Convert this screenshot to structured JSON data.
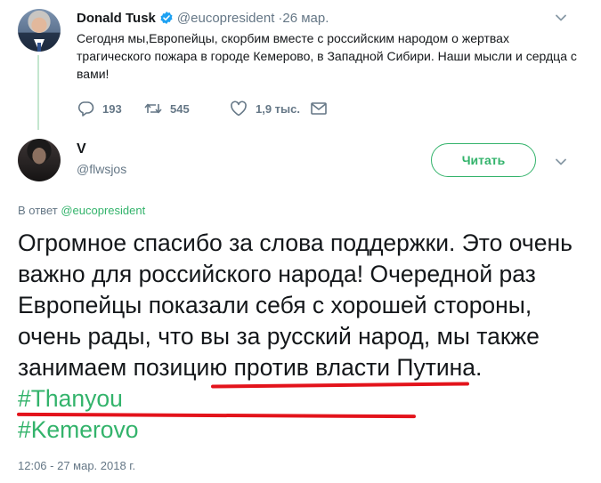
{
  "original_tweet": {
    "author_name": "Donald Tusk",
    "author_handle": "@eucopresident",
    "date": "·26 мар.",
    "text": "Сегодня мы,Европейцы, скорбим вместе с российским народом о жертвах трагического пожара в городе Кемерово, в Западной Сибири. Наши мысли и сердца с вами!",
    "replies": "193",
    "retweets": "545",
    "likes": "1,9 тыс.",
    "verified_icon": "verified-badge-icon"
  },
  "reply_tweet": {
    "author_name": "V",
    "author_handle": "@flwsjos",
    "follow_label": "Читать",
    "reply_to_prefix": "В ответ",
    "reply_to_handle": "@eucopresident",
    "text_parts": {
      "line1": "Огромное спасибо за слова поддержки. Это очень важно для российского народа! Очередной раз Европейцы показали себя с хорошей стороны, очень рады, что вы за русский народ, ",
      "highlighted": "мы также занимаем позицию против власти Путина",
      "after": ". ",
      "hashtag1": "#Thanyou",
      "hashtag2": "#Kemerovo"
    },
    "timestamp": "12:06 - 27 мар. 2018 г."
  },
  "colors": {
    "accent": "#33b36b",
    "thread_line": "#c4e6cf",
    "muted": "#657786",
    "text": "#14171a",
    "underline": "#e3131b",
    "verified": "#1da1f2"
  }
}
